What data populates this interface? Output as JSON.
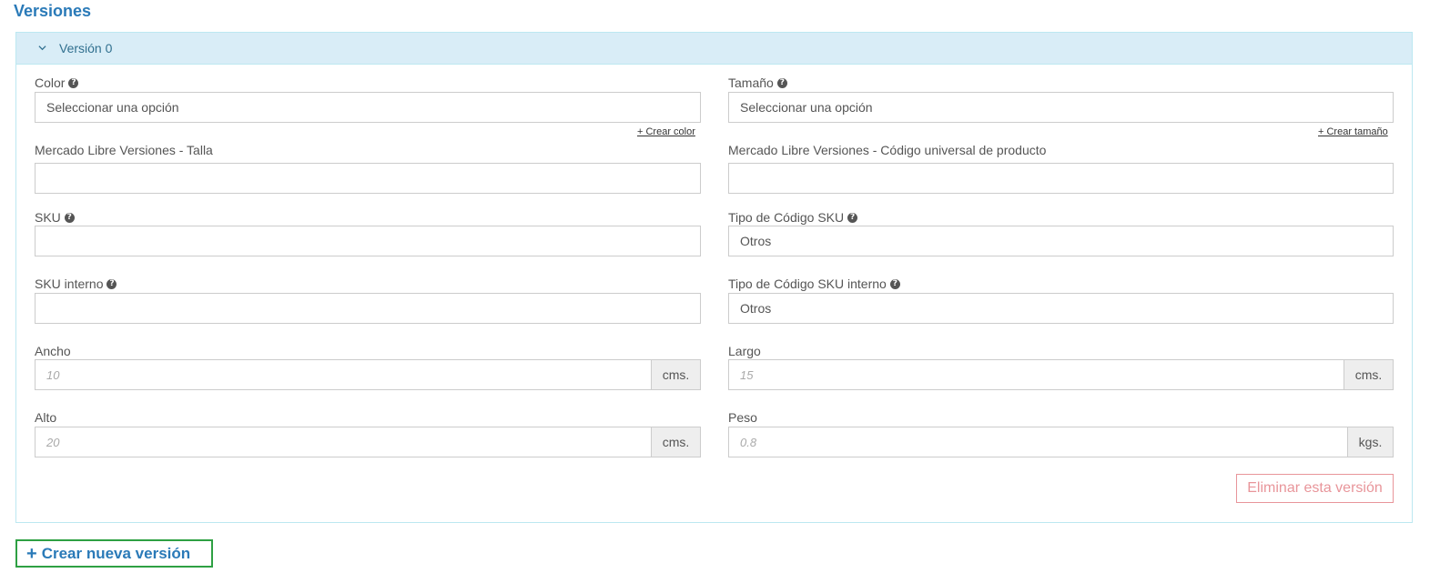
{
  "section_title": "Versiones",
  "panel": {
    "title": "Versión 0"
  },
  "fields": {
    "color": {
      "label": "Color",
      "value": "Seleccionar una opción",
      "create_link": "+ Crear color"
    },
    "tamano": {
      "label": "Tamaño",
      "value": "Seleccionar una opción",
      "create_link": "+ Crear tamaño"
    },
    "ml_talla": {
      "label": "Mercado Libre Versiones - Talla",
      "value": ""
    },
    "ml_upc": {
      "label": "Mercado Libre Versiones - Código universal de producto",
      "value": ""
    },
    "sku": {
      "label": "SKU",
      "value": ""
    },
    "tipo_sku": {
      "label": "Tipo de Código SKU",
      "value": "Otros"
    },
    "sku_interno": {
      "label": "SKU interno",
      "value": ""
    },
    "tipo_sku_interno": {
      "label": "Tipo de Código SKU interno",
      "value": "Otros"
    },
    "ancho": {
      "label": "Ancho",
      "placeholder": "10",
      "unit": "cms."
    },
    "largo": {
      "label": "Largo",
      "placeholder": "15",
      "unit": "cms."
    },
    "alto": {
      "label": "Alto",
      "placeholder": "20",
      "unit": "cms."
    },
    "peso": {
      "label": "Peso",
      "placeholder": "0.8",
      "unit": "kgs."
    }
  },
  "buttons": {
    "delete_version": "Eliminar esta versión",
    "new_version": "Crear nueva versión"
  },
  "icons": {
    "help": "question-circle-icon",
    "chevron": "chevron-down-icon",
    "plus": "plus-icon"
  },
  "colors": {
    "title_blue": "#2a7ab8",
    "panel_head_bg": "#d9edf7",
    "delete_red": "#e8959a",
    "new_border_green": "#2ea043"
  }
}
